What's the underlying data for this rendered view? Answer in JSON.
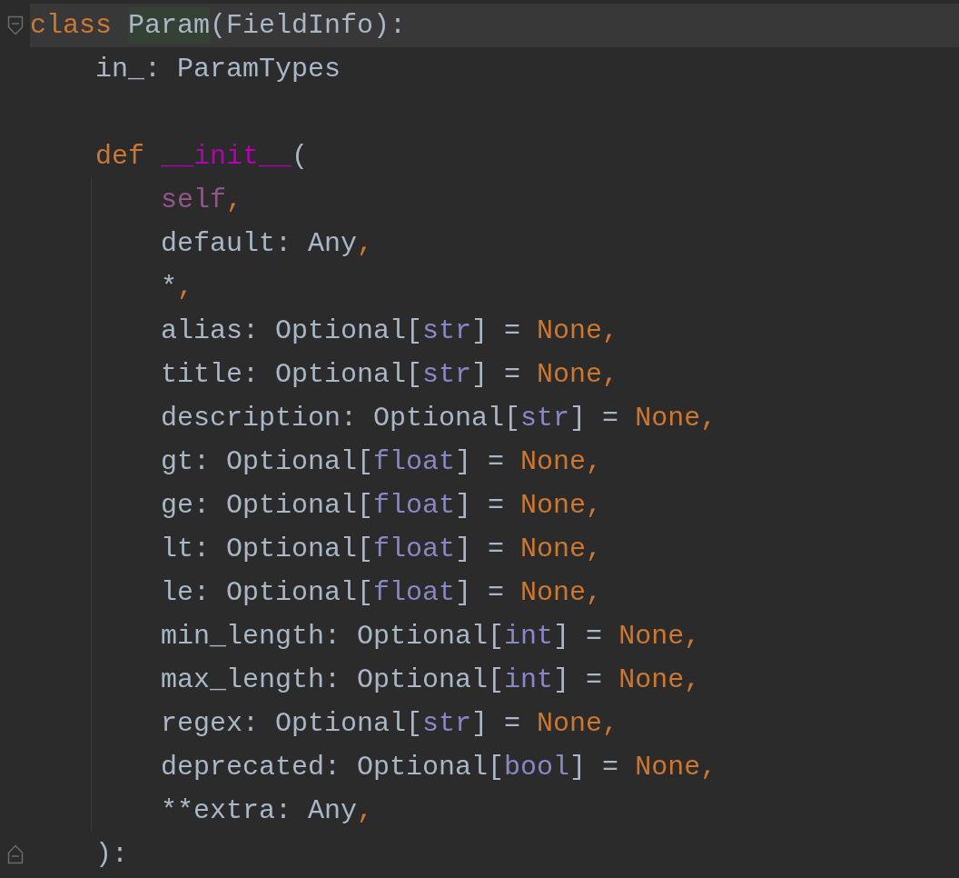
{
  "editor": {
    "lines": [
      {
        "kind": "code",
        "current": true,
        "fold": {
          "kind": "start"
        },
        "tokens": [
          {
            "kind": "keyword",
            "text": "class "
          },
          {
            "kind": "usage",
            "text": "Param"
          },
          {
            "kind": "plain",
            "text": "(FieldInfo):"
          }
        ]
      },
      {
        "kind": "code",
        "current": false,
        "tokens": [
          {
            "kind": "plain",
            "text": "    in_: ParamTypes"
          }
        ]
      },
      {
        "kind": "blank"
      },
      {
        "kind": "code",
        "current": false,
        "tokens": [
          {
            "kind": "keyword",
            "text": "    def "
          },
          {
            "kind": "dunder",
            "text": "__init__"
          },
          {
            "kind": "plain",
            "text": "("
          }
        ]
      },
      {
        "kind": "code",
        "current": false,
        "tokens": [
          {
            "kind": "self",
            "text": "        self"
          },
          {
            "kind": "punct",
            "text": ","
          }
        ]
      },
      {
        "kind": "code",
        "current": false,
        "tokens": [
          {
            "kind": "plain",
            "text": "        default: Any"
          },
          {
            "kind": "punct",
            "text": ","
          }
        ]
      },
      {
        "kind": "code",
        "current": false,
        "tokens": [
          {
            "kind": "plain",
            "text": "        *"
          },
          {
            "kind": "punct",
            "text": ","
          }
        ]
      },
      {
        "kind": "code",
        "current": false,
        "tokens": [
          {
            "kind": "plain",
            "text": "        alias: Optional["
          },
          {
            "kind": "builtin",
            "text": "str"
          },
          {
            "kind": "plain",
            "text": "] = "
          },
          {
            "kind": "keyword",
            "text": "None,"
          }
        ]
      },
      {
        "kind": "code",
        "current": false,
        "tokens": [
          {
            "kind": "plain",
            "text": "        title: Optional["
          },
          {
            "kind": "builtin",
            "text": "str"
          },
          {
            "kind": "plain",
            "text": "] = "
          },
          {
            "kind": "keyword",
            "text": "None,"
          }
        ]
      },
      {
        "kind": "code",
        "current": false,
        "tokens": [
          {
            "kind": "plain",
            "text": "        description: Optional["
          },
          {
            "kind": "builtin",
            "text": "str"
          },
          {
            "kind": "plain",
            "text": "] = "
          },
          {
            "kind": "keyword",
            "text": "None,"
          }
        ]
      },
      {
        "kind": "code",
        "current": false,
        "tokens": [
          {
            "kind": "plain",
            "text": "        gt: Optional["
          },
          {
            "kind": "builtin",
            "text": "float"
          },
          {
            "kind": "plain",
            "text": "] = "
          },
          {
            "kind": "keyword",
            "text": "None,"
          }
        ]
      },
      {
        "kind": "code",
        "current": false,
        "tokens": [
          {
            "kind": "plain",
            "text": "        ge: Optional["
          },
          {
            "kind": "builtin",
            "text": "float"
          },
          {
            "kind": "plain",
            "text": "] = "
          },
          {
            "kind": "keyword",
            "text": "None,"
          }
        ]
      },
      {
        "kind": "code",
        "current": false,
        "tokens": [
          {
            "kind": "plain",
            "text": "        lt: Optional["
          },
          {
            "kind": "builtin",
            "text": "float"
          },
          {
            "kind": "plain",
            "text": "] = "
          },
          {
            "kind": "keyword",
            "text": "None,"
          }
        ]
      },
      {
        "kind": "code",
        "current": false,
        "tokens": [
          {
            "kind": "plain",
            "text": "        le: Optional["
          },
          {
            "kind": "builtin",
            "text": "float"
          },
          {
            "kind": "plain",
            "text": "] = "
          },
          {
            "kind": "keyword",
            "text": "None,"
          }
        ]
      },
      {
        "kind": "code",
        "current": false,
        "tokens": [
          {
            "kind": "plain",
            "text": "        min_length: Optional["
          },
          {
            "kind": "builtin",
            "text": "int"
          },
          {
            "kind": "plain",
            "text": "] = "
          },
          {
            "kind": "keyword",
            "text": "None,"
          }
        ]
      },
      {
        "kind": "code",
        "current": false,
        "tokens": [
          {
            "kind": "plain",
            "text": "        max_length: Optional["
          },
          {
            "kind": "builtin",
            "text": "int"
          },
          {
            "kind": "plain",
            "text": "] = "
          },
          {
            "kind": "keyword",
            "text": "None,"
          }
        ]
      },
      {
        "kind": "code",
        "current": false,
        "tokens": [
          {
            "kind": "plain",
            "text": "        regex: Optional["
          },
          {
            "kind": "builtin",
            "text": "str"
          },
          {
            "kind": "plain",
            "text": "] = "
          },
          {
            "kind": "keyword",
            "text": "None,"
          }
        ]
      },
      {
        "kind": "code",
        "current": false,
        "tokens": [
          {
            "kind": "plain",
            "text": "        deprecated: Optional["
          },
          {
            "kind": "builtin",
            "text": "bool"
          },
          {
            "kind": "plain",
            "text": "] = "
          },
          {
            "kind": "keyword",
            "text": "None,"
          }
        ]
      },
      {
        "kind": "code",
        "current": false,
        "tokens": [
          {
            "kind": "plain",
            "text": "        **extra: Any"
          },
          {
            "kind": "punct",
            "text": ","
          }
        ]
      },
      {
        "kind": "code",
        "current": false,
        "fold": {
          "kind": "end"
        },
        "tokens": [
          {
            "kind": "plain",
            "text": "    ):"
          }
        ]
      }
    ]
  }
}
